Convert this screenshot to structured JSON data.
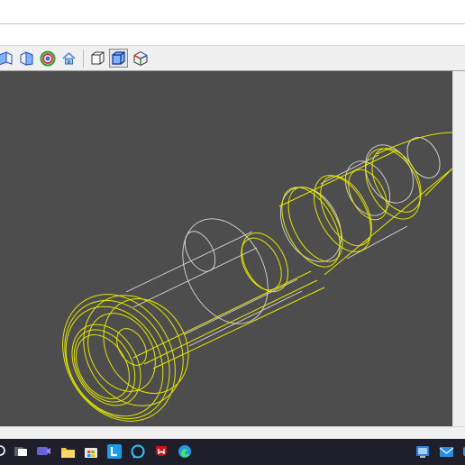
{
  "toolbar": {
    "buttons": [
      {
        "name": "view-left-icon"
      },
      {
        "name": "view-right-icon"
      },
      {
        "name": "view-target-icon"
      },
      {
        "name": "view-home-icon"
      },
      {
        "name": "view-box-outline-icon"
      },
      {
        "name": "view-box-solid-icon",
        "pressed": true
      },
      {
        "name": "view-axes-cube-icon"
      }
    ]
  },
  "viewport": {
    "background": "#4d4d4d",
    "selected_color": "#e6e600",
    "unselected_color": "#d9d9d9"
  },
  "taskbar": {
    "icons": [
      "search-icon",
      "task-view-icon",
      "chat-icon",
      "file-explorer-icon",
      "store-icon",
      "l-app-icon",
      "alexa-icon",
      "mcafee-icon",
      "edge-icon",
      "tray-app-icon",
      "mail-icon",
      "notification-icon"
    ]
  }
}
